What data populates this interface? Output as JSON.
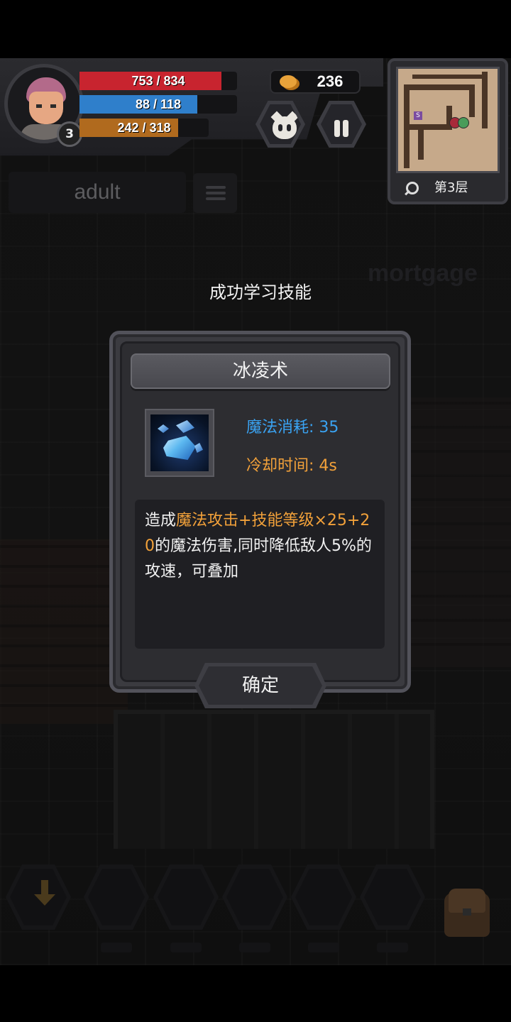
{
  "hud": {
    "level": "3",
    "hp": {
      "text": "753 / 834",
      "current": 753,
      "max": 834,
      "color": "#c8242f"
    },
    "mp": {
      "text": "88 / 118",
      "current": 88,
      "max": 118,
      "color": "#2f7fcb"
    },
    "exp": {
      "text": "242 / 318",
      "current": 242,
      "max": 318,
      "color": "#b06a1e"
    },
    "gold": "236",
    "pet_button_icon": "pet-face-icon",
    "pause_button_icon": "pause-icon"
  },
  "minimap": {
    "floor_label": "第3层",
    "stairs_marker": "S",
    "search_icon": "magnifier-icon"
  },
  "background": {
    "faded_word_1": "adult",
    "faded_word_2": "mortgage"
  },
  "notification": "成功学习技能",
  "dialog": {
    "skill_name": "冰凌术",
    "skill_icon": "ice-shard-icon",
    "mana_cost": "魔法消耗: 35",
    "cooldown": "冷却时间: 4s",
    "description": {
      "p1": "造成",
      "p2": "魔法攻击+技能等级×25+20",
      "p3": "的魔法伤害,同时降低敌人5%的攻速，可叠加"
    },
    "confirm_label": "确定",
    "colors": {
      "mana": "#3aa3f2",
      "cooldown": "#f2a13a",
      "highlight": "#f2a13a"
    }
  },
  "bottom_bar": {
    "drop_icon": "down-arrow-icon",
    "bag_icon": "backpack-icon",
    "skill_slots": 5
  }
}
